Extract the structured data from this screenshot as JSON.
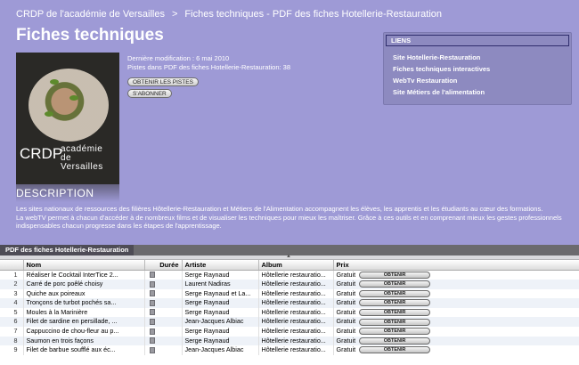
{
  "breadcrumb": {
    "first": "CRDP de l'académie de Versailles",
    "separator": ">",
    "second": "Fiches techniques - PDF des fiches Hotellerie-Restauration"
  },
  "title": "Fiches techniques",
  "artwork": {
    "brand": "CRDP",
    "subtitle_line1": "académie de",
    "subtitle_line2": "Versailles"
  },
  "meta": {
    "last_modified": "Dernière modification : 6 mai 2010",
    "tracks": "Pistes dans PDF des fiches Hotellerie-Restauration: 38"
  },
  "buttons": {
    "get_tracks": "OBTENIR LES PISTES",
    "subscribe": "S'ABONNER"
  },
  "liens": {
    "heading": "LIENS",
    "items": [
      "Site Hotellerie-Restauration",
      "Fiches techniques interactives",
      "WebTv Restauration",
      "Site Métiers de l'alimentation"
    ]
  },
  "description": {
    "heading": "DESCRIPTION",
    "p1": "Les sites nationaux de ressources des filières Hôtellerie-Restauration et Métiers de l'Alimentation accompagnent les élèves, les apprentis et les étudiants au cœur des formations.",
    "p2": "La webTV permet à chacun d'accéder à de nombreux films et de visualiser les techniques pour mieux les maîtriser. Grâce à ces outils et en comprenant mieux les gestes professionnels indispensables chacun progresse dans les étapes de l'apprentissage."
  },
  "tab": {
    "label": "PDF des fiches Hotellerie-Restauration"
  },
  "table": {
    "headers": {
      "name": "Nom",
      "duration": "Durée",
      "artist": "Artiste",
      "album": "Album",
      "price": "Prix"
    },
    "rows": [
      {
        "num": "1",
        "name": "Réaliser le Cocktail InterTice 2...",
        "duration": "",
        "artist": "Serge Raynaud",
        "album": "Hôtellerie restauratio...",
        "price": "Gratuit",
        "action": "OBTENIR"
      },
      {
        "num": "2",
        "name": "Carré de porc poêlé choisy",
        "duration": "",
        "artist": "Laurent Nadiras",
        "album": "Hôtellerie restauratio...",
        "price": "Gratuit",
        "action": "OBTENIR"
      },
      {
        "num": "3",
        "name": "Quiche aux poireaux",
        "duration": "",
        "artist": "Serge Raynaud et La...",
        "album": "Hôtellerie restauratio...",
        "price": "Gratuit",
        "action": "OBTENIR"
      },
      {
        "num": "4",
        "name": "Tronçons de turbot pochés sa...",
        "duration": "",
        "artist": "Serge Raynaud",
        "album": "Hôtellerie restauratio...",
        "price": "Gratuit",
        "action": "OBTENIR"
      },
      {
        "num": "5",
        "name": "Moules à la Marinière",
        "duration": "",
        "artist": "Serge Raynaud",
        "album": "Hôtellerie restauratio...",
        "price": "Gratuit",
        "action": "OBTENIR"
      },
      {
        "num": "6",
        "name": "Filet de sardine en persillade, ...",
        "duration": "",
        "artist": "Jean-Jacques Albiac",
        "album": "Hôtellerie restauratio...",
        "price": "Gratuit",
        "action": "OBTENIR"
      },
      {
        "num": "7",
        "name": "Cappuccino de chou-fleur au p...",
        "duration": "",
        "artist": "Serge Raynaud",
        "album": "Hôtellerie restauratio...",
        "price": "Gratuit",
        "action": "OBTENIR"
      },
      {
        "num": "8",
        "name": "Saumon en trois façons",
        "duration": "",
        "artist": "Serge Raynaud",
        "album": "Hôtellerie restauratio...",
        "price": "Gratuit",
        "action": "OBTENIR"
      },
      {
        "num": "9",
        "name": "Filet de barbue soufflé aux éc...",
        "duration": "",
        "artist": "Jean-Jacques Albiac",
        "album": "Hôtellerie restauratio...",
        "price": "Gratuit",
        "action": "OBTENIR"
      }
    ]
  }
}
